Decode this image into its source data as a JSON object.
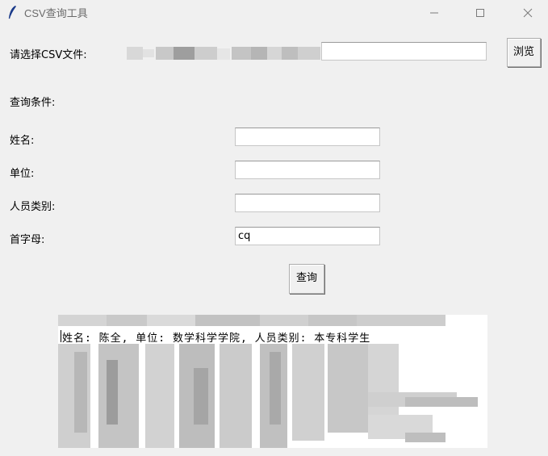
{
  "window": {
    "title": "CSV查询工具",
    "controls": [
      "minimize-icon",
      "maximize-icon",
      "close-icon"
    ]
  },
  "file_row": {
    "label": "请选择CSV文件:",
    "path_value": "",
    "browse_label": "浏览"
  },
  "query": {
    "section_label": "查询条件:",
    "fields": [
      {
        "label": "姓名:",
        "value": ""
      },
      {
        "label": "单位:",
        "value": ""
      },
      {
        "label": "人员类别:",
        "value": ""
      },
      {
        "label": "首字母:",
        "value": "cq"
      }
    ],
    "button_label": "查询"
  },
  "results": {
    "first_line": "姓名: 陈全, 单位: 数学科学学院, 人员类别: 本专科学生"
  },
  "colors": {
    "window_bg": "#f0f0f0",
    "entry_bg": "#ffffff",
    "title_text": "#6a6a6a"
  }
}
